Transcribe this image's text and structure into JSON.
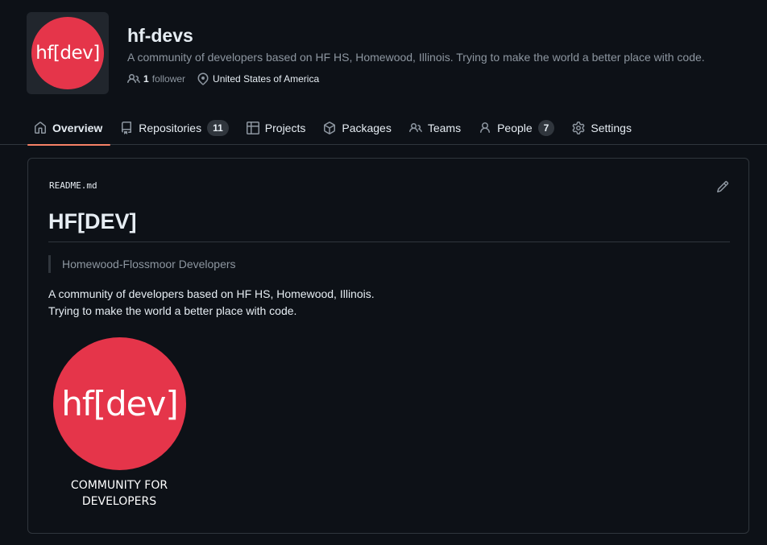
{
  "colors": {
    "brand_red": "#e5354a",
    "accent_underline": "#f78166",
    "background": "#0d1117",
    "border": "#30363d"
  },
  "org": {
    "avatar_text": "hf[dev]",
    "name": "hf-devs",
    "description": "A community of developers based on HF HS, Homewood, Illinois. Trying to make the world a better place with code.",
    "follower_count": "1",
    "follower_label": "follower",
    "location": "United States of America"
  },
  "nav": {
    "tabs": [
      {
        "label": "Overview",
        "icon": "home-icon",
        "active": true
      },
      {
        "label": "Repositories",
        "icon": "repo-icon",
        "count": "11"
      },
      {
        "label": "Projects",
        "icon": "table-icon"
      },
      {
        "label": "Packages",
        "icon": "package-icon"
      },
      {
        "label": "Teams",
        "icon": "people-icon"
      },
      {
        "label": "People",
        "icon": "person-icon",
        "count": "7"
      },
      {
        "label": "Settings",
        "icon": "gear-icon"
      }
    ]
  },
  "readme": {
    "filename": "README.md",
    "title": "HF[DEV]",
    "quote": "Homewood-Flossmoor Developers",
    "body_line1": "A community of developers based on HF HS, Homewood, Illinois.",
    "body_line2": "Trying to make the world a better place with code.",
    "logo_text": "hf[dev]",
    "caption_line1": "COMMUNITY FOR",
    "caption_line2": "DEVELOPERS"
  }
}
